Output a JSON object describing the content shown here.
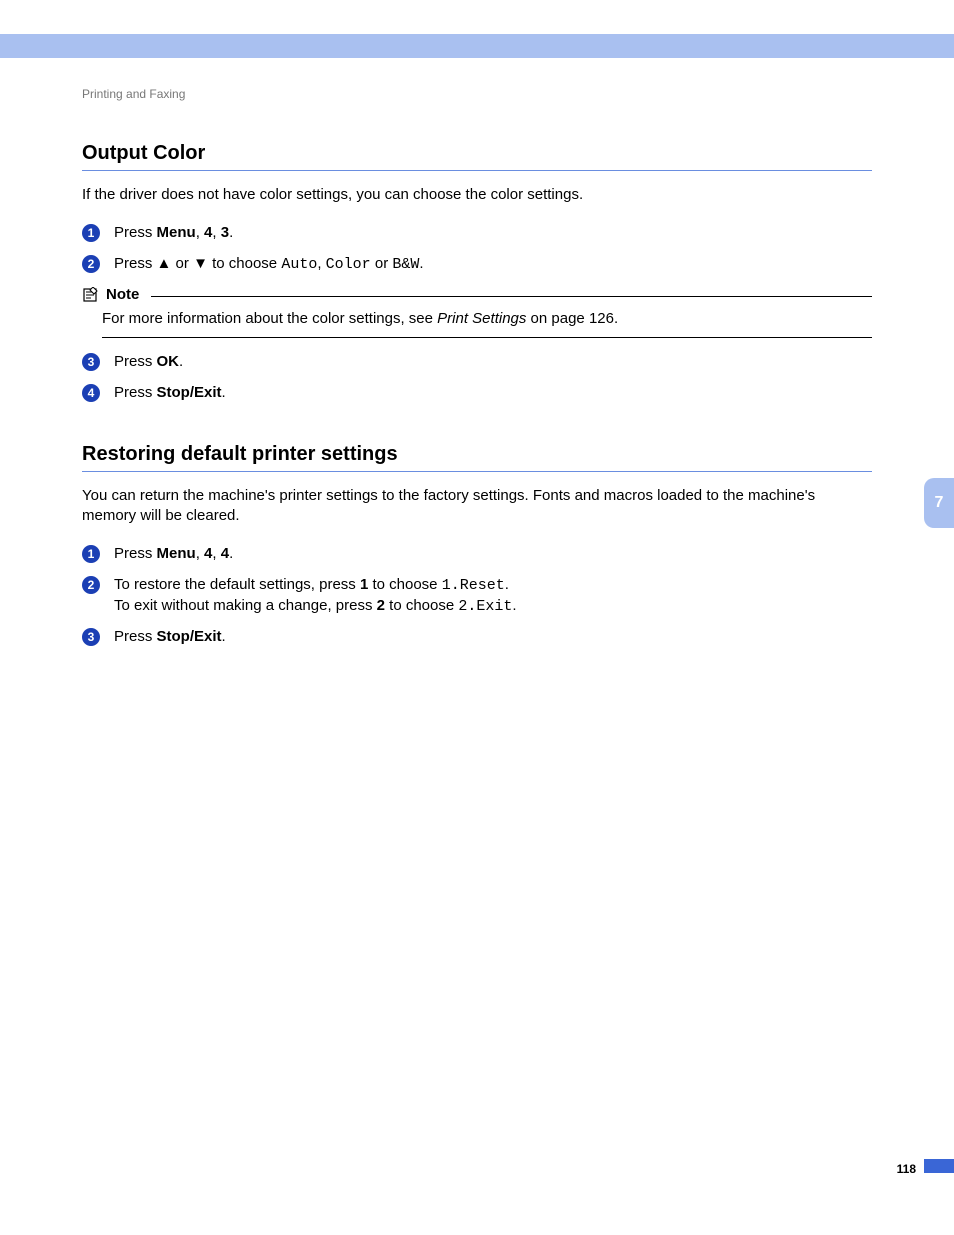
{
  "breadcrumb": "Printing and Faxing",
  "section1": {
    "title": "Output Color",
    "intro": "If the driver does not have color settings, you can choose the color settings.",
    "step1": {
      "num": "1",
      "prefix": "Press ",
      "b1": "Menu",
      "sep1": ", ",
      "b2": "4",
      "sep2": ", ",
      "b3": "3",
      "suffix": "."
    },
    "step2": {
      "num": "2",
      "t1": "Press ",
      "up": "▲",
      "t2": " or ",
      "down": "▼",
      "t3": " to choose ",
      "m1": "Auto",
      "c1": ", ",
      "m2": "Color",
      "c2": " or ",
      "m3": "B&W",
      "t4": "."
    },
    "note": {
      "label": "Note",
      "t1": "For more information about the color settings, see ",
      "link": "Print Settings",
      "t2": " on page 126."
    },
    "step3": {
      "num": "3",
      "prefix": "Press ",
      "b1": "OK",
      "suffix": "."
    },
    "step4": {
      "num": "4",
      "prefix": "Press ",
      "b1": "Stop/Exit",
      "suffix": "."
    }
  },
  "section2": {
    "title": "Restoring default printer settings",
    "intro": "You can return the machine's printer settings to the factory settings. Fonts and macros loaded to the machine's memory will be cleared.",
    "step1": {
      "num": "1",
      "prefix": "Press ",
      "b1": "Menu",
      "sep1": ", ",
      "b2": "4",
      "sep2": ", ",
      "b3": "4",
      "suffix": "."
    },
    "step2": {
      "num": "2",
      "l1a": "To restore the default settings, press ",
      "l1b": "1",
      "l1c": " to choose ",
      "l1m": "1.Reset",
      "l1d": ".",
      "l2a": "To exit without making a change, press ",
      "l2b": "2",
      "l2c": " to choose ",
      "l2m": "2.Exit",
      "l2d": "."
    },
    "step3": {
      "num": "3",
      "prefix": "Press ",
      "b1": "Stop/Exit",
      "suffix": "."
    }
  },
  "sidetab": "7",
  "pagenum": "118"
}
